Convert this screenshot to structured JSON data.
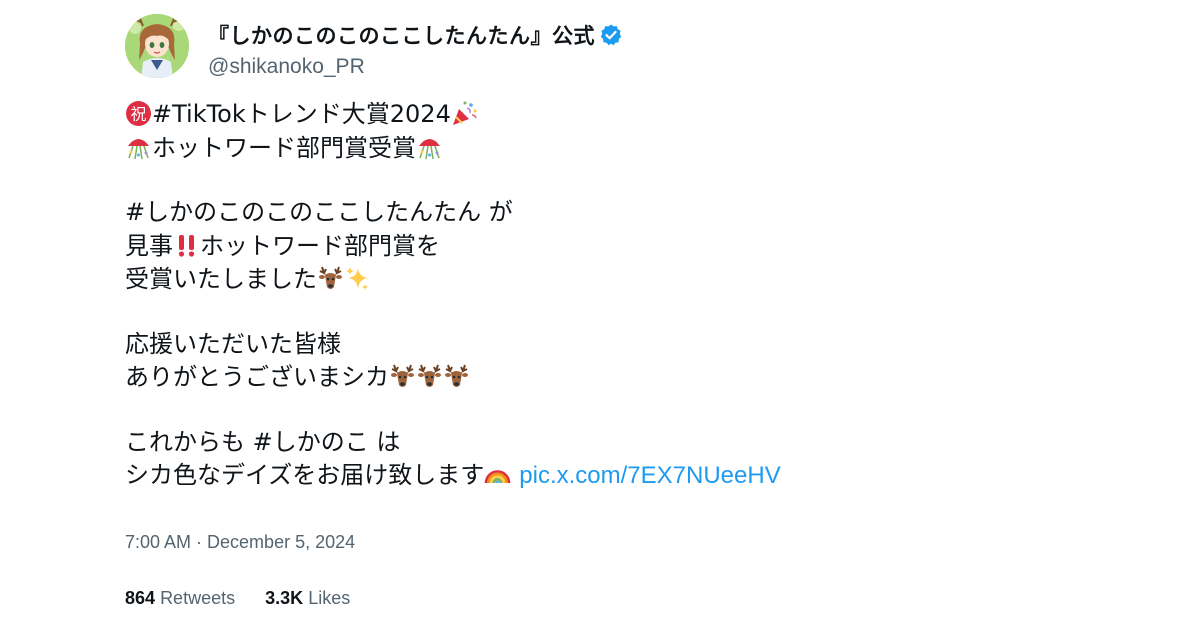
{
  "author": {
    "display_name": "『しかのこのこのここしたんたん』公式",
    "handle": "@shikanoko_PR",
    "verified": true,
    "avatar_icon": "anime-character-avatar"
  },
  "tweet": {
    "lines": [
      {
        "text": "#TikTokトレンド大賞2024",
        "lead_emoji": "congratulation-kanji-icon",
        "trail_emoji": "party-popper-icon"
      },
      {
        "text": "ホットワード部門賞受賞",
        "lead_emoji": "confetti-ball-icon",
        "trail_emoji": "confetti-ball-icon"
      },
      {
        "text": ""
      },
      {
        "text": "#しかのこのこのここしたんたん が"
      },
      {
        "text_before": "見事",
        "emoji": "double-exclamation-icon",
        "text_after": "ホットワード部門賞を"
      },
      {
        "text": "受賞いたしました",
        "trail_emojis": [
          "deer-icon",
          "sparkles-icon"
        ]
      },
      {
        "text": ""
      },
      {
        "text": "応援いただいた皆様"
      },
      {
        "text": "ありがとうございまシカ",
        "trail_emojis": [
          "deer-icon",
          "deer-icon",
          "deer-icon"
        ]
      },
      {
        "text": ""
      },
      {
        "text": "これからも #しかのこ は"
      },
      {
        "text": "シカ色なデイズをお届け致します",
        "trail_emojis": [
          "rainbow-icon"
        ],
        "link": "pic.x.com/7EX7NUeeHV"
      }
    ],
    "timestamp": "7:00 AM · December 5, 2024",
    "retweets_count": "864",
    "retweets_label": "Retweets",
    "likes_count": "3.3K",
    "likes_label": "Likes"
  },
  "colors": {
    "text": "#0f1419",
    "secondary": "#536471",
    "link": "#1d9bf0",
    "verified": "#1d9bf0"
  }
}
